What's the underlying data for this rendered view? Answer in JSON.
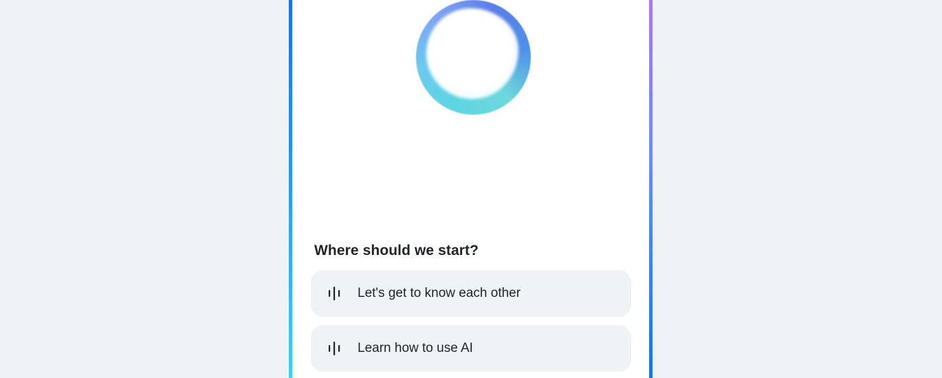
{
  "section_title": "Where should we start?",
  "suggestions": [
    {
      "label": "Let's get to know each other",
      "icon": "voice-wave-icon"
    },
    {
      "label": "Learn how to use AI",
      "icon": "voice-wave-icon"
    }
  ],
  "colors": {
    "page_background": "#eff3f6",
    "panel_background": "#ffffff",
    "suggestion_background": "#eff3f6",
    "text": "#1f2328",
    "frame_blue": "#1a74e0",
    "frame_cyan": "#3ed2e6",
    "frame_purple": "#a77ae6"
  }
}
